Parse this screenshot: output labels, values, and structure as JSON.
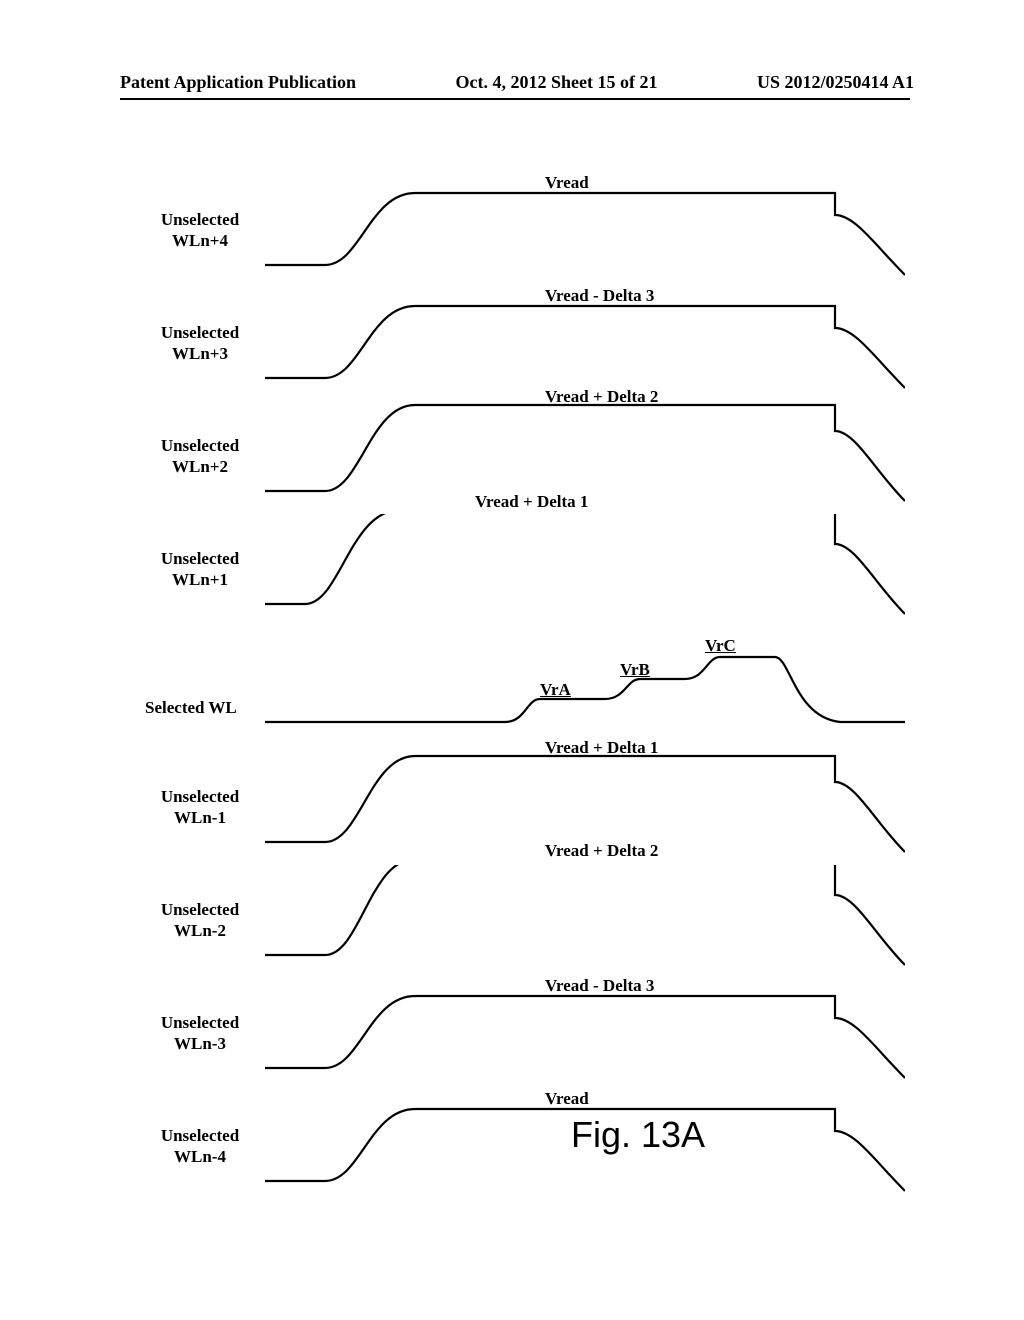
{
  "header": {
    "left": "Patent Application Publication",
    "center": "Oct. 4, 2012  Sheet 15 of 21",
    "right": "US 2012/0250414 A1"
  },
  "waveforms": {
    "wln_plus4": {
      "label": "Unselected\nWLn+4",
      "voltage": "Vread"
    },
    "wln_plus3": {
      "label": "Unselected\nWLn+3",
      "voltage": "Vread - Delta 3"
    },
    "wln_plus2": {
      "label": "Unselected\nWLn+2",
      "voltage": "Vread + Delta 2"
    },
    "wln_plus1": {
      "label": "Unselected\nWLn+1",
      "voltage": "Vread + Delta 1"
    },
    "selected": {
      "label": "Selected WL",
      "steps": {
        "a": "VrA",
        "b": "VrB",
        "c": "VrC"
      }
    },
    "wln_minus1": {
      "label": "Unselected\nWLn-1",
      "voltage": "Vread + Delta 1"
    },
    "wln_minus2": {
      "label": "Unselected\nWLn-2",
      "voltage": "Vread + Delta 2"
    },
    "wln_minus3": {
      "label": "Unselected\nWLn-3",
      "voltage": "Vread - Delta 3"
    },
    "wln_minus4": {
      "label": "Unselected\nWLn-4",
      "voltage": "Vread"
    }
  },
  "figure_caption": "Fig. 13A"
}
